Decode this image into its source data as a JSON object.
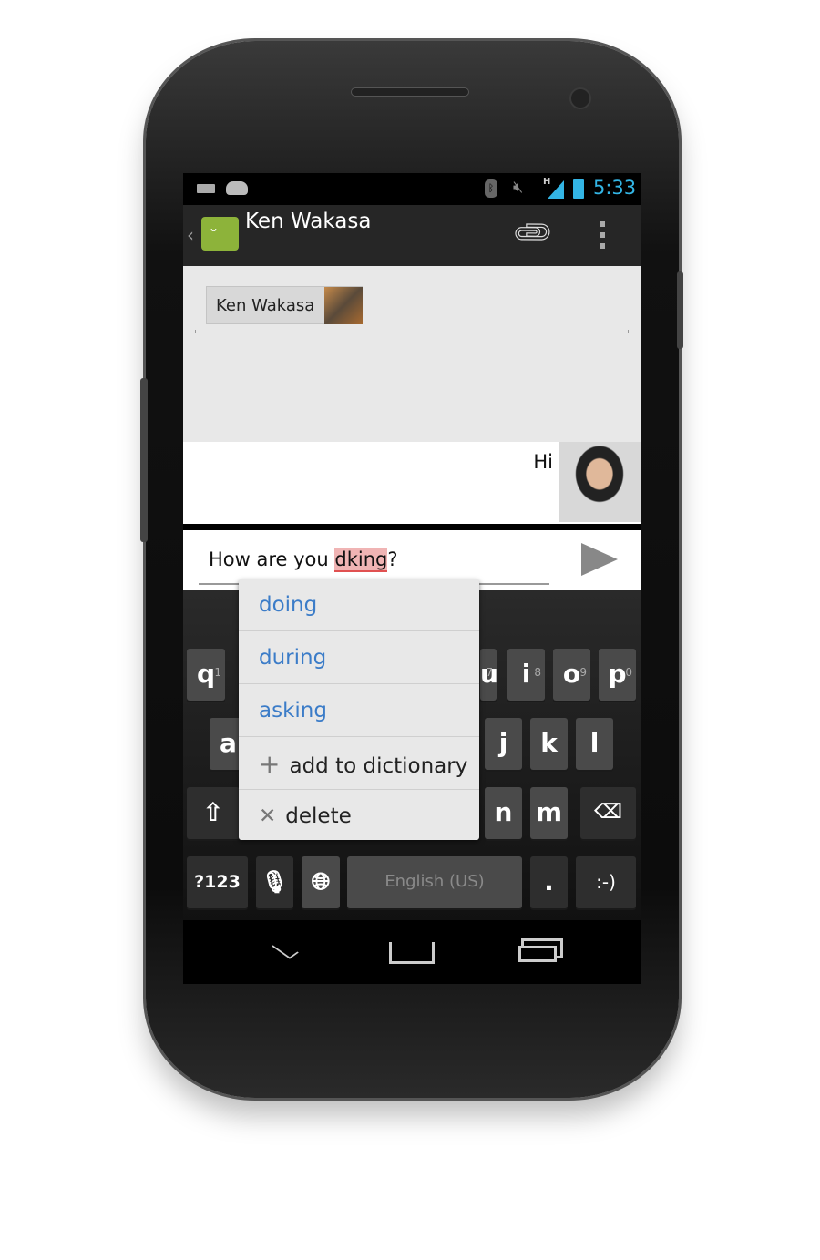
{
  "status_bar": {
    "time": "5:33",
    "icons": [
      "keyboard-icon",
      "android-icon",
      "bluetooth-icon",
      "mute-icon",
      "signal-icon",
      "battery-icon"
    ],
    "network_type": "H"
  },
  "action_bar": {
    "title": "Ken Wakasa",
    "icons": [
      "back-icon",
      "messaging-app-icon",
      "attach-icon",
      "overflow-menu-icon"
    ]
  },
  "recipient": {
    "chip_name": "Ken Wakasa"
  },
  "messages": [
    {
      "text": "Hi",
      "sender": "self"
    }
  ],
  "compose": {
    "text_before": "How are you ",
    "misspelled": "dking",
    "text_after": "?"
  },
  "suggestion_popup": {
    "suggestions": [
      "doing",
      "during",
      "asking"
    ],
    "add_label": "add to dictionary",
    "delete_label": "delete"
  },
  "keyboard": {
    "row1": [
      {
        "k": "q",
        "h": "1"
      },
      {
        "k": "i",
        "h": "8"
      },
      {
        "k": "o",
        "h": "9"
      },
      {
        "k": "p",
        "h": "0"
      }
    ],
    "row1_partial": {
      "k": "u",
      "h": "7"
    },
    "row2": [
      "a",
      "j",
      "k",
      "l"
    ],
    "row3": [
      "n",
      "m"
    ],
    "symbols_label": "?123",
    "space_label": "English (US)",
    "period": ".",
    "smiley": ":-)"
  },
  "colors": {
    "accent": "#33b5e5",
    "suggestion": "#3b7cc8",
    "misspelled_highlight": "#f0b4b4",
    "app_icon": "#8db33a"
  }
}
